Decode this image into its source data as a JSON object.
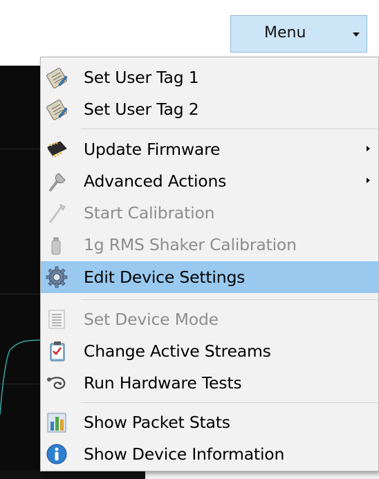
{
  "menu_button": {
    "label": "Menu",
    "background": "#cde6f7"
  },
  "menu_items": [
    {
      "label": "Set User Tag 1",
      "icon": "notepad-pencil-icon",
      "enabled": true,
      "has_submenu": false,
      "highlighted": false
    },
    {
      "label": "Set User Tag 2",
      "icon": "notepad-pencil-icon",
      "enabled": true,
      "has_submenu": false,
      "highlighted": false
    },
    {
      "label": "Update Firmware",
      "icon": "chip-icon",
      "enabled": true,
      "has_submenu": true,
      "highlighted": false
    },
    {
      "label": "Advanced Actions",
      "icon": "wrench-icon",
      "enabled": true,
      "has_submenu": true,
      "highlighted": false
    },
    {
      "label": "Start Calibration",
      "icon": "calibration-tool-icon",
      "enabled": false,
      "has_submenu": false,
      "highlighted": false
    },
    {
      "label": "1g RMS Shaker Calibration",
      "icon": "shaker-icon",
      "enabled": false,
      "has_submenu": false,
      "highlighted": false
    },
    {
      "label": "Edit Device Settings",
      "icon": "gear-icon",
      "enabled": true,
      "has_submenu": false,
      "highlighted": true
    },
    {
      "label": "Set Device Mode",
      "icon": "list-icon",
      "enabled": false,
      "has_submenu": false,
      "highlighted": false
    },
    {
      "label": "Change Active Streams",
      "icon": "clipboard-checklist-icon",
      "enabled": true,
      "has_submenu": false,
      "highlighted": false
    },
    {
      "label": "Run Hardware Tests",
      "icon": "stethoscope-icon",
      "enabled": true,
      "has_submenu": false,
      "highlighted": false
    },
    {
      "label": "Show Packet Stats",
      "icon": "bar-chart-icon",
      "enabled": true,
      "has_submenu": false,
      "highlighted": false
    },
    {
      "label": "Show Device Information",
      "icon": "info-icon",
      "enabled": true,
      "has_submenu": false,
      "highlighted": false
    }
  ],
  "colors": {
    "highlight": "#99c9ef",
    "disabled_text": "#8d8d8d",
    "menu_background": "#f2f2f2"
  }
}
